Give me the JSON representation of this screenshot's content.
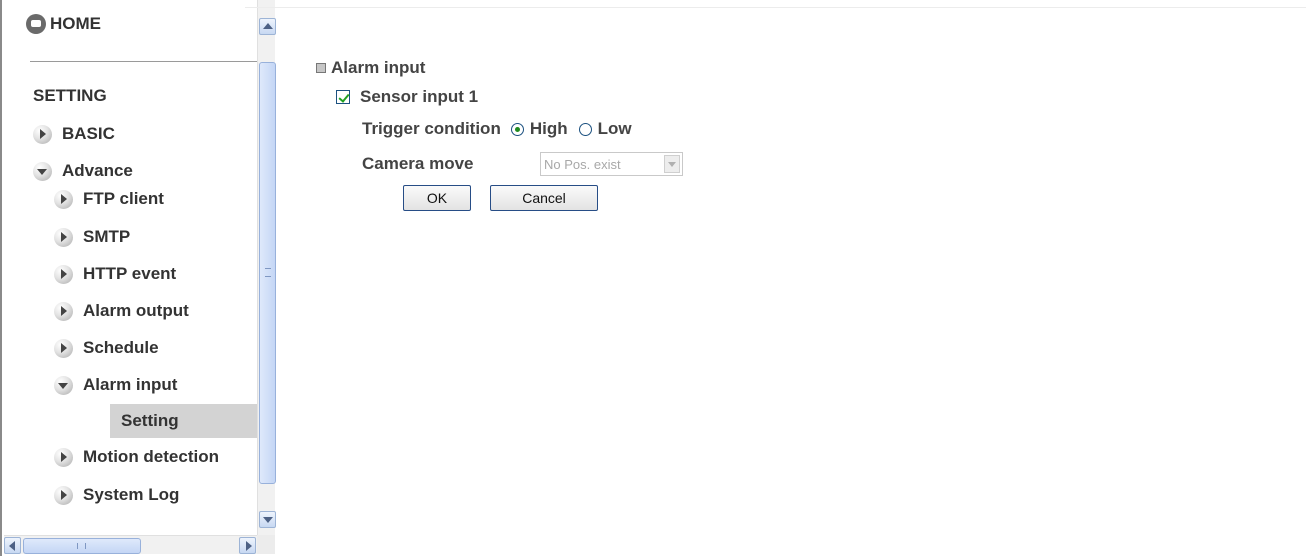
{
  "sidebar": {
    "home_label": "HOME",
    "setting_title": "SETTING",
    "basic_label": "BASIC",
    "advance_label": "Advance",
    "items": [
      {
        "label": "FTP client"
      },
      {
        "label": "SMTP"
      },
      {
        "label": "HTTP event"
      },
      {
        "label": "Alarm output"
      },
      {
        "label": "Schedule"
      },
      {
        "label": "Alarm input"
      },
      {
        "label": "Motion detection"
      },
      {
        "label": "System Log"
      }
    ],
    "selected_subitem": "Setting"
  },
  "main": {
    "section_title": "Alarm input",
    "sensor": {
      "label": "Sensor input 1",
      "checked": true
    },
    "trigger": {
      "label": "Trigger condition",
      "options": [
        "High",
        "Low"
      ],
      "selected": "High"
    },
    "camera_move": {
      "label": "Camera move",
      "value": "No Pos. exist",
      "disabled": true
    },
    "buttons": {
      "ok": "OK",
      "cancel": "Cancel"
    }
  },
  "icons": {
    "home": "home-icon",
    "nav_collapsed": "arrow-right-icon",
    "nav_expanded": "arrow-down-icon",
    "section_bullet": "square-bullet-icon"
  },
  "colors": {
    "selected_item_bg": "#d3d3d3",
    "text": "#444444",
    "control_border": "#1c5180",
    "checkmark": "#21a121"
  }
}
